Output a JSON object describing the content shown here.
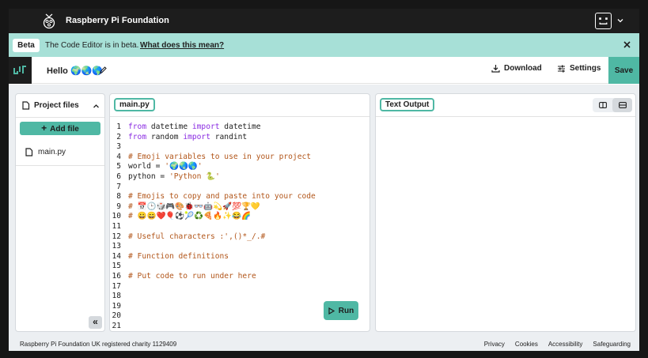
{
  "header": {
    "org_name": "Raspberry Pi Foundation",
    "logo_icon": "raspberry-logo-icon",
    "avatar_icon": "robot-avatar-icon"
  },
  "beta_banner": {
    "badge": "Beta",
    "message": "The Code Editor is in beta.",
    "link": "What does this mean?"
  },
  "project_bar": {
    "project_name": "Hello 🌍🌏🌎",
    "download_label": "Download",
    "settings_label": "Settings",
    "save_label": "Save"
  },
  "sidebar": {
    "title": "Project files",
    "add_file_label": "Add file",
    "files": [
      "main.py"
    ],
    "collapse_label": "«"
  },
  "editor": {
    "tab_label": "main.py",
    "run_label": "Run",
    "lines": [
      [
        {
          "t": "kw",
          "v": "from"
        },
        {
          "t": "tx",
          "v": " datetime "
        },
        {
          "t": "kw",
          "v": "import"
        },
        {
          "t": "tx",
          "v": " datetime"
        }
      ],
      [
        {
          "t": "kw",
          "v": "from"
        },
        {
          "t": "tx",
          "v": " random "
        },
        {
          "t": "kw",
          "v": "import"
        },
        {
          "t": "tx",
          "v": " randint"
        }
      ],
      [],
      [
        {
          "t": "cm",
          "v": "# Emoji variables to use in your project"
        }
      ],
      [
        {
          "t": "tx",
          "v": "world = "
        },
        {
          "t": "str",
          "v": "'🌍🌏🌎'"
        }
      ],
      [
        {
          "t": "tx",
          "v": "python = "
        },
        {
          "t": "str",
          "v": "'Python 🐍'"
        }
      ],
      [],
      [
        {
          "t": "cm",
          "v": "# Emojis to copy and paste into your code"
        }
      ],
      [
        {
          "t": "cm",
          "v": "# 📅🕒🎲🎮🎨🐞👓🤖💫🚀💯🏆💛"
        }
      ],
      [
        {
          "t": "cm",
          "v": "# 😀😄❤️🎈⚽🎾♻️🍕🔥✨😂🌈"
        }
      ],
      [],
      [
        {
          "t": "cm",
          "v": "# Useful characters :',()*_/.#"
        }
      ],
      [],
      [
        {
          "t": "cm",
          "v": "# Function definitions"
        }
      ],
      [],
      [
        {
          "t": "cm",
          "v": "# Put code to run under here"
        }
      ],
      [],
      [],
      [],
      [],
      []
    ]
  },
  "output": {
    "tab_label": "Text Output"
  },
  "footer": {
    "charity": "Raspberry Pi Foundation UK registered charity 1129409",
    "links": [
      "Privacy",
      "Cookies",
      "Accessibility",
      "Safeguarding"
    ]
  }
}
